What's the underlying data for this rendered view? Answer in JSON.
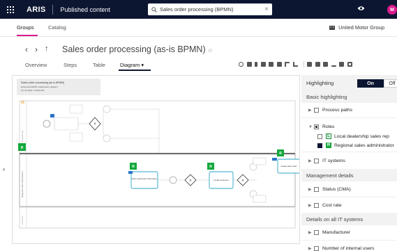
{
  "topbar": {
    "brand": "ARIS",
    "section": "Published content",
    "search_value": "Sales order processing (BPMN)",
    "avatar_initial": "M"
  },
  "nav": {
    "tabs": [
      "Groups",
      "Catalog"
    ],
    "org": "United Motor Group"
  },
  "page": {
    "title": "Sales order processing (as-is BPMN)",
    "star": "☆",
    "subtabs": [
      "Overview",
      "Steps",
      "Table",
      "Diagram ▾"
    ]
  },
  "diagram": {
    "header_title": "Sales order processing (as is BPMN)",
    "header_sub1": "Enterprise BPMN collaboration diagram",
    "header_sub2": "Oct 11 2023, 4:18:00 PM",
    "role_badge": "R",
    "task_a": "Enter opportunity information",
    "task_b": "Create Customer",
    "task_c": "Create new customer request data",
    "task_d": "Create sales order",
    "lane_a": "Local dealership",
    "lane_b": "Regional sales administrator",
    "lane_c": "Customer"
  },
  "panel": {
    "title": "Highlighting",
    "on_label": "On",
    "off_label": "Off",
    "basic": "Basic highlighting",
    "process_paths": "Process paths",
    "roles": "Roles",
    "role_local_badge": "L",
    "role_local": "Local dealership sales rep",
    "role_regional_badge": "R",
    "role_regional": "Regional sales administrator",
    "it_systems": "IT systems",
    "mgmt": "Management details",
    "status": "Status (CMA)",
    "cost": "Cost rate",
    "details_it": "Details on all IT systems",
    "manufacturer": "Manufacturer",
    "internal_users": "Number of internal users"
  },
  "colors": {
    "topbar": "#0d1631",
    "accent": "#d81b8c",
    "role_green": "#12a83b",
    "task_border": "#2aa4c9"
  }
}
